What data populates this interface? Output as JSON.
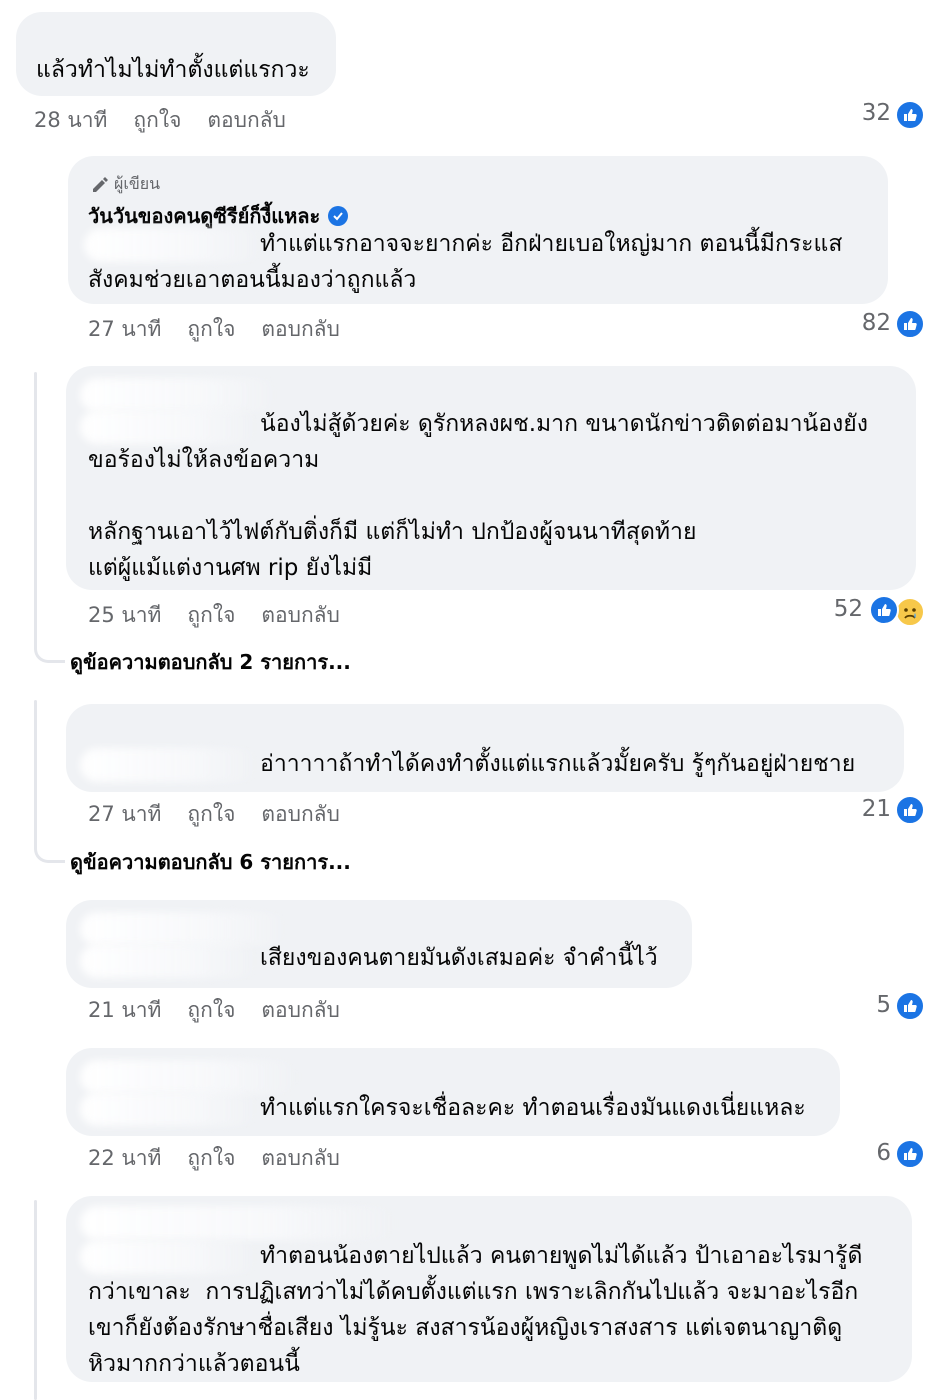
{
  "comments": [
    {
      "text": "แล้วทำไมไม่ทำตั้งแต่แรกวะ",
      "time": "28 นาที",
      "like_label": "ถูกใจ",
      "reply_label": "ตอบกลับ",
      "reaction_count": "32",
      "reactions": [
        "like-icon"
      ]
    },
    {
      "author_tag": "ผู้เขียน",
      "author": "วันวันของคนดูซีรีย์ก็งี้แหละ",
      "verified": true,
      "text": "ทำแต่แรกอาจจะยากค่ะ อีกฝ่ายเบอใหญ่มาก ตอนนี้มีกระแส\nสังคมช่วยเอาตอนนี้มองว่าถูกแล้ว",
      "time": "27 นาที",
      "like_label": "ถูกใจ",
      "reply_label": "ตอบกลับ",
      "reaction_count": "82",
      "reactions": [
        "like-icon"
      ]
    },
    {
      "text": "น้องไม่สู้ด้วยค่ะ ดูรักหลงผช.มาก ขนาดนักข่าวติดต่อมาน้องยัง\nขอร้องไม่ให้ลงข้อความ\n\nหลักฐานเอาไว้ไฟต์กับติ่งก็มี แต่ก็ไม่ทำ ปกป้องผู้จนนาทีสุดท้าย\nแต่ผู้แม้แต่งานศพ rip ยังไม่มี",
      "time": "25 นาที",
      "like_label": "ถูกใจ",
      "reply_label": "ตอบกลับ",
      "reaction_count": "52",
      "reactions": [
        "like-icon",
        "sad-icon"
      ],
      "view_replies": "ดูข้อความตอบกลับ 2 รายการ..."
    },
    {
      "text": "อ่าาาาาถ้าทำได้คงทำตั้งแต่แรกแล้วมั้ยครับ รู้ๆกันอยู่ฝ่ายชาย",
      "time": "27 นาที",
      "like_label": "ถูกใจ",
      "reply_label": "ตอบกลับ",
      "reaction_count": "21",
      "reactions": [
        "like-icon"
      ],
      "view_replies": "ดูข้อความตอบกลับ 6 รายการ..."
    },
    {
      "text": "เสียงของคนตายมันดังเสมอค่ะ จำคำนี้ไว้",
      "time": "21 นาที",
      "like_label": "ถูกใจ",
      "reply_label": "ตอบกลับ",
      "reaction_count": "5",
      "reactions": [
        "like-icon"
      ]
    },
    {
      "text": "ทำแต่แรกใครจะเชื่อละคะ ทำตอนเรื่องมันแดงเนี่ยแหละ",
      "time": "22 นาที",
      "like_label": "ถูกใจ",
      "reply_label": "ตอบกลับ",
      "reaction_count": "6",
      "reactions": [
        "like-icon"
      ]
    },
    {
      "text": "ทำตอนน้องตายไปแล้ว คนตายพูดไม่ได้แล้ว ป้าเอาอะไรมารู้ดี\nกว่าเขาละ  การปฏิเสทว่าไม่ได้คบตั้งแต่แรก เพราะเลิกกันไปแล้ว จะมาอะไรอีก\nเขาก็ยังต้องรักษาชื่อเสียง ไม่รู้นะ สงสารน้องผู้หญิงเราสงสาร แต่เจตนาญาติดู\nหิวมากกว่าแล้วตอนนี้"
    }
  ],
  "colors": {
    "bubble": "#f0f2f5",
    "meta_text": "#65676b",
    "like_blue": "#1b74e4",
    "sad_yellow": "#f7c84a"
  }
}
